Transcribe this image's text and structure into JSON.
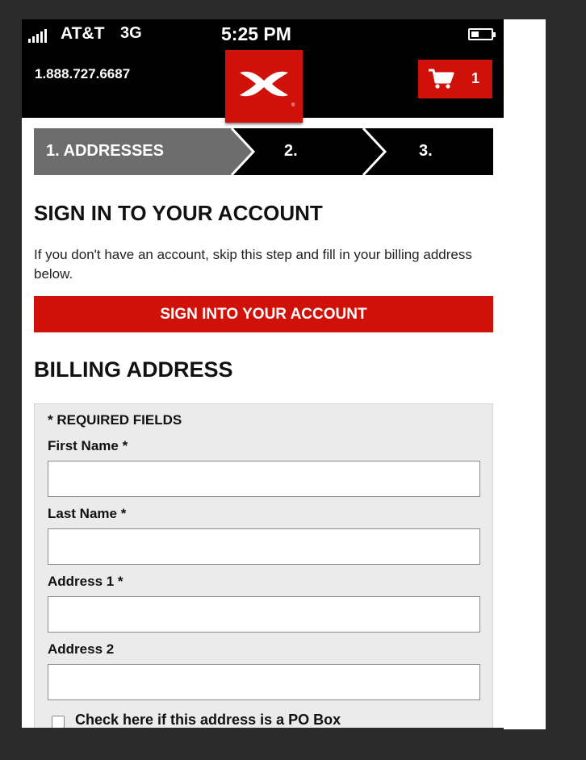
{
  "status_bar": {
    "carrier": "AT&T",
    "network": "3G",
    "time": "5:25 PM"
  },
  "header": {
    "phone_number": "1.888.727.6687",
    "logo_icon": "under-armour-logo",
    "cart_icon": "shopping-cart-icon",
    "cart_count": "1"
  },
  "steps": [
    {
      "label": "1. ADDRESSES",
      "active": true
    },
    {
      "label": "2.",
      "active": false
    },
    {
      "label": "3.",
      "active": false
    }
  ],
  "sign_in": {
    "heading_bold": "SIGN IN",
    "heading_rest": " TO YOUR ACCOUNT",
    "info": "If you don't have an account, skip this step and fill in your billing address below.",
    "button_label": "SIGN INTO YOUR ACCOUNT"
  },
  "billing": {
    "heading_bold": "BILLING",
    "heading_rest": " ADDRESS",
    "required_note": "* REQUIRED FIELDS",
    "fields": [
      {
        "label": "First Name *",
        "value": ""
      },
      {
        "label": "Last Name *",
        "value": ""
      },
      {
        "label": "Address 1 *",
        "value": ""
      },
      {
        "label": "Address 2",
        "value": ""
      }
    ],
    "po_box_label": "Check here if this address is a PO Box"
  },
  "colors": {
    "brand_red": "#d0110a",
    "bar_black": "#000000",
    "step_active_gray": "#6d6d6d",
    "panel_gray": "#ebebeb"
  }
}
